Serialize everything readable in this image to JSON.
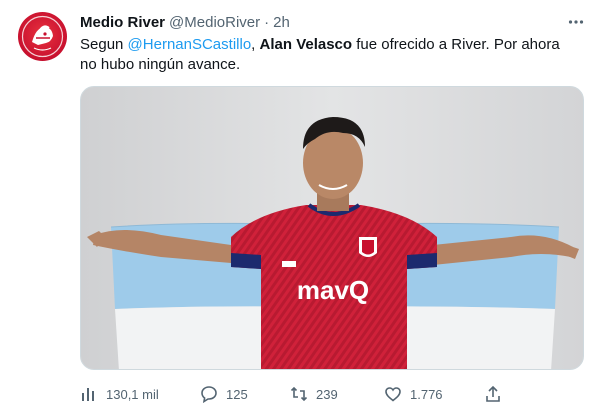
{
  "tweet": {
    "author_name": "Medio River",
    "author_handle": "@MedioRiver",
    "separator": "·",
    "timestamp": "2h",
    "text_pre": "Segun ",
    "mention": "@HernanSCastillo",
    "text_comma": ", ",
    "bold_name": "Alan Velasco",
    "text_post": " fue ofrecido a River. Por ahora no hubo ningún avance.",
    "media": {
      "jersey_sponsor": "mavQ",
      "badge": "FC DALLAS"
    }
  },
  "actions": {
    "views": "130,1 mil",
    "replies": "125",
    "retweets": "239",
    "likes": "1.776"
  },
  "icons": {
    "views": "analytics-icon",
    "reply": "reply-icon",
    "retweet": "retweet-icon",
    "like": "heart-icon",
    "share": "share-icon",
    "more": "more-icon"
  },
  "colors": {
    "link": "#1d9bf0",
    "secondary": "#536471",
    "avatar_red": "#c8102e",
    "jersey_red": "#d0213a",
    "flag_blue": "#9ecbea"
  }
}
